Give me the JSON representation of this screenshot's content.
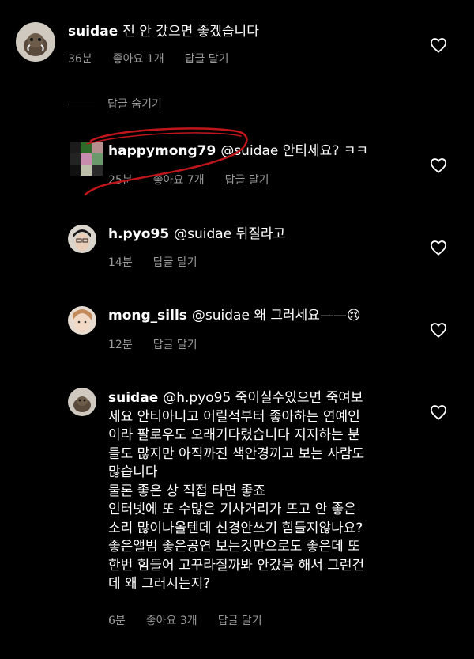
{
  "comments": [
    {
      "username": "suidae",
      "text": "전 안 갔으면 좋겠습니다",
      "time": "36분",
      "likes": "좋아요 1개",
      "reply": "답글 달기"
    },
    {
      "username": "happymong79",
      "text": "@suidae 안티세요? ㅋㅋ",
      "time": "25분",
      "likes": "좋아요 7개",
      "reply": "답글 달기"
    },
    {
      "username": "h.pyo95",
      "text": "@suidae 뒤질라고",
      "time": "14분",
      "reply": "답글 달기"
    },
    {
      "username": "mong_sills",
      "text": "@suidae 왜 그러세요——😢",
      "time": "12분",
      "reply": "답글 달기"
    },
    {
      "username": "suidae",
      "text_lines": [
        "@h.pyo95 죽이실수있으면 죽여보",
        "세요 안티아니고 어릴적부터 좋아하는 연예인",
        "이라 팔로우도 오래기다렸습니다 지지하는 분",
        "들도 많지만 아직까진 색안경끼고 보는 사람도",
        "많습니다",
        "물론 좋은 상 직접 타면 좋죠",
        "인터넷에 또 수많은 기사거리가 뜨고 안 좋은",
        "소리 많이나올텐데 신경안쓰기 힘들지않나요?",
        "좋은앨범 좋은공연 보는것만으로도 좋은데 또",
        "한번 힘들어 고꾸라질까봐 안갔음 해서 그런건",
        "데 왜 그러시는지?"
      ],
      "time": "6분",
      "likes": "좋아요 3개",
      "reply": "답글 달기"
    }
  ],
  "hide_replies": "답글 숨기기",
  "icons": {
    "like": "heart-icon"
  },
  "colors": {
    "background": "#000000",
    "meta": "#9a9a9a",
    "annotation": "#c0161b"
  }
}
